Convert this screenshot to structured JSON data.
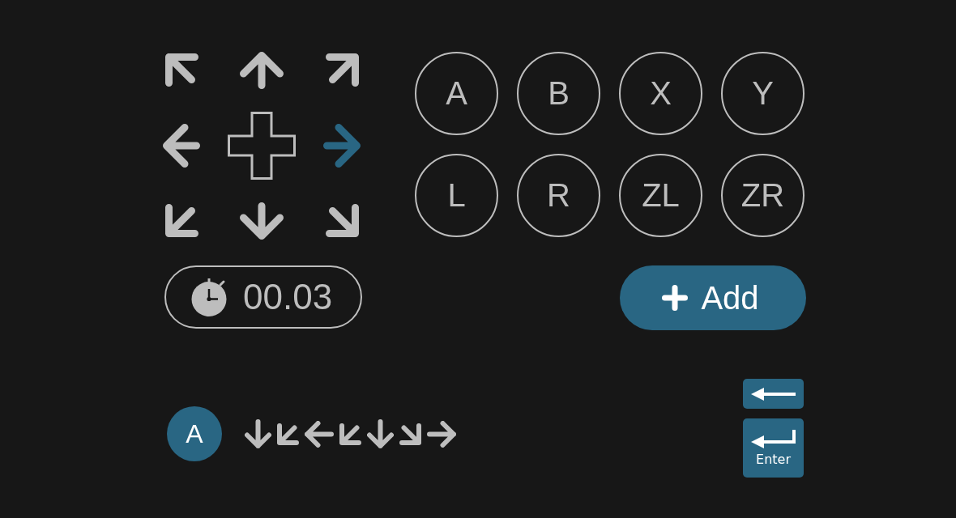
{
  "dpad": {
    "directions": [
      {
        "kind": "up-left",
        "selected": false
      },
      {
        "kind": "up",
        "selected": false
      },
      {
        "kind": "up-right",
        "selected": false
      },
      {
        "kind": "left",
        "selected": false
      },
      {
        "kind": "right",
        "selected": true
      },
      {
        "kind": "down-left",
        "selected": false
      },
      {
        "kind": "down",
        "selected": false
      },
      {
        "kind": "down-right",
        "selected": false
      }
    ]
  },
  "buttons": [
    {
      "label": "A"
    },
    {
      "label": "B"
    },
    {
      "label": "X"
    },
    {
      "label": "Y"
    },
    {
      "label": "L"
    },
    {
      "label": "R"
    },
    {
      "label": "ZL"
    },
    {
      "label": "ZR"
    }
  ],
  "timer": {
    "value": "00.03"
  },
  "add_button": {
    "label": "Add"
  },
  "command": {
    "button": "A",
    "moves": [
      {
        "kind": "down"
      },
      {
        "kind": "down-left"
      },
      {
        "kind": "left"
      },
      {
        "kind": "down-left"
      },
      {
        "kind": "down"
      },
      {
        "kind": "down-right"
      },
      {
        "kind": "right"
      }
    ]
  },
  "keys": [
    {
      "kind": "backspace"
    },
    {
      "kind": "enter",
      "label": "Enter"
    }
  ]
}
